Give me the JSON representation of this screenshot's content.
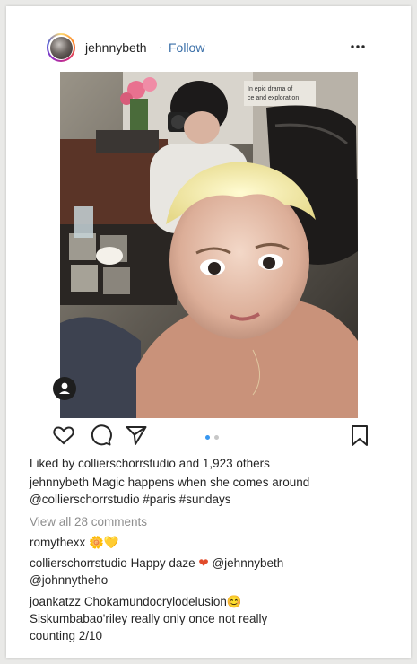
{
  "post": {
    "username": "jehnnybeth",
    "separator": "·",
    "follow_label": "Follow",
    "photo_caption_overlay": "In epic drama of\nce and exploration",
    "likes_text": "Liked by collierschorrstudio and 1,923 others",
    "caption": {
      "username": "jehnnybeth",
      "line1": "Magic happens when she comes around",
      "line2": "@collierschorrstudio #paris #sundays"
    },
    "view_comments_label": "View all 28 comments",
    "comments": [
      {
        "username": "romythexx",
        "emoji": "🌼💛"
      },
      {
        "username": "collierschorrstudio",
        "text": "Happy daze",
        "emoji": "❤",
        "mentions_line1": "@jehnnybeth",
        "line2": "@johnnytheho"
      },
      {
        "username": "joankatzz",
        "text": "Chokamundocrylodelusion",
        "emoji": "😊",
        "line2": "Siskumbabao'riley really only once not really",
        "line3": "counting 2/10"
      }
    ]
  },
  "carousel": {
    "count": 2,
    "active_index": 0
  },
  "colors": {
    "link": "#3a6fa8",
    "active_dot": "#3897f0",
    "inactive_dot": "#c7c7c7",
    "muted": "#8e8e8e"
  },
  "icons": [
    "heart-icon",
    "comment-icon",
    "share-icon",
    "bookmark-icon",
    "more-options-icon",
    "user-tag-icon"
  ]
}
